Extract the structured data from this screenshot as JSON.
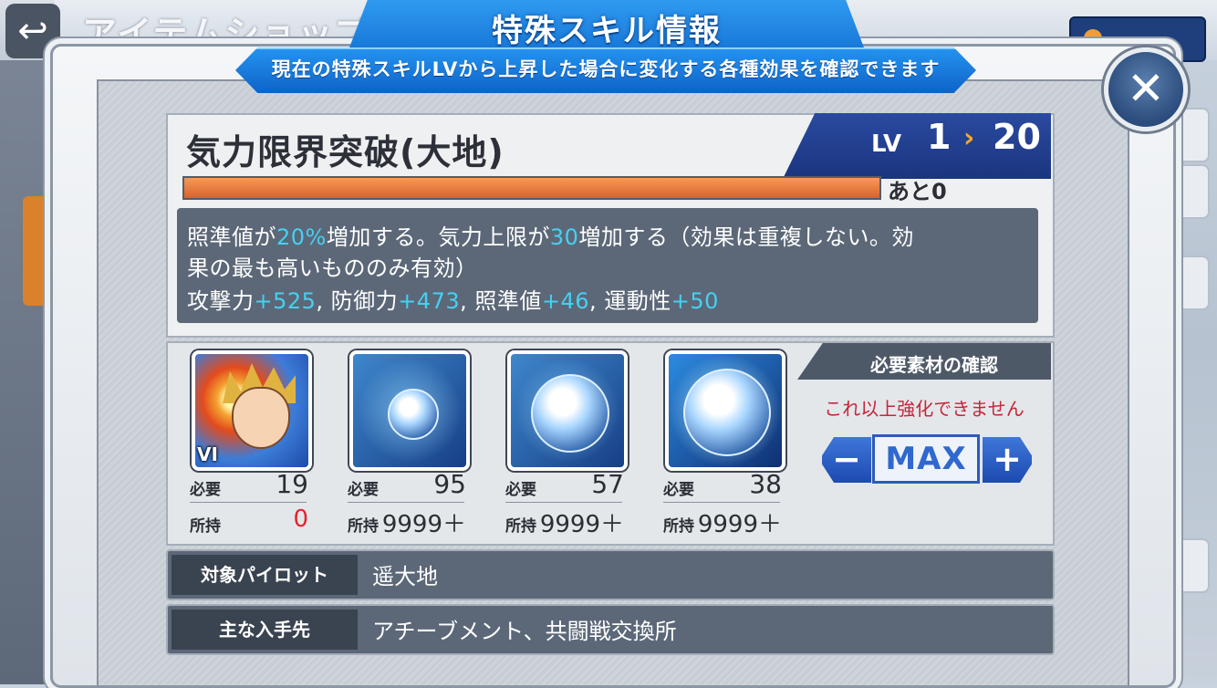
{
  "background": {
    "back_icon": "back-arrow-icon",
    "title": "アイテムショップ"
  },
  "dialog": {
    "title": "特殊スキル情報",
    "subtitle": "現在の特殊スキルLVから上昇した場合に変化する各種効果を確認できます",
    "close_icon": "close-icon"
  },
  "skill": {
    "name": "気力限界突破(大地)",
    "lv_label": "LV",
    "lv_current": "1",
    "lv_arrow": "›",
    "lv_max": "20",
    "exp_remaining": "あと0",
    "exp_progress": 1.0,
    "desc_line1": {
      "a": "照準値が",
      "b": "20%",
      "c": "増加する。気力上限が",
      "d": "30",
      "e": "増加する（効果は重複しない。効"
    },
    "desc_line2": "果の最も高いもののみ有効）",
    "stats": {
      "atk_label": "攻撃力",
      "atk": "+525",
      "def_label": ", 防御力",
      "def": "+473",
      "aim_label": ", 照準値",
      "aim": "+46",
      "mob_label": ", 運動性",
      "mob": "+50"
    }
  },
  "materials": {
    "need_label": "必要",
    "own_label": "所持",
    "items": [
      {
        "icon": "pilot-portrait-icon",
        "tag": "VI",
        "need": "19",
        "own": "0"
      },
      {
        "icon": "small-orb-icon",
        "need": "95",
        "own": "9999＋"
      },
      {
        "icon": "medium-orb-icon",
        "need": "57",
        "own": "9999＋"
      },
      {
        "icon": "large-orb-icon",
        "need": "38",
        "own": "9999＋"
      }
    ],
    "confirm_title": "必要素材の確認",
    "no_upgrade": "これ以上強化できません",
    "minus": "−",
    "max": "MAX",
    "plus": "+"
  },
  "info": {
    "pilot_key": "対象パイロット",
    "pilot_val": "遥大地",
    "source_key": "主な入手先",
    "source_val": "アチーブメント、共闘戦交換所"
  },
  "colors": {
    "accent_blue": "#1674d6",
    "highlight_cyan": "#46d0f2",
    "warning_red": "#c6253a",
    "exp_orange": "#d9632a"
  }
}
